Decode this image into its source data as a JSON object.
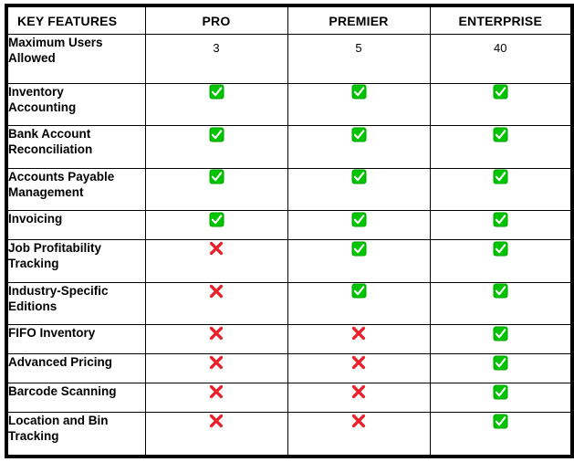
{
  "table": {
    "columns": [
      "KEY FEATURES",
      "PRO",
      "PREMIER",
      "ENTERPRISE"
    ],
    "icons": {
      "yes": "green-check-icon",
      "no": "red-cross-icon"
    },
    "colors": {
      "check_fill": "#00c400",
      "check_fill_dark": "#00a200",
      "check_glyph": "#ffffff",
      "cross": "#e8202a",
      "border": "#000000",
      "background": "#ffffff",
      "text": "#000000"
    },
    "rows": [
      {
        "feature": "Maximum Users Allowed",
        "lines": [
          "Maximum Users",
          "Allowed"
        ],
        "type": "text",
        "height": "tall",
        "pro": "3",
        "premier": "5",
        "enterprise": "40"
      },
      {
        "feature": "Inventory Accounting",
        "lines": [
          "Inventory",
          "Accounting"
        ],
        "type": "icon",
        "height": "tall",
        "pro": "yes",
        "premier": "yes",
        "enterprise": "yes"
      },
      {
        "feature": "Bank Account Reconciliation",
        "lines": [
          "Bank Account",
          "Reconciliation"
        ],
        "type": "icon",
        "height": "tall",
        "pro": "yes",
        "premier": "yes",
        "enterprise": "yes"
      },
      {
        "feature": "Accounts Payable Management",
        "lines": [
          "Accounts Payable",
          "Management"
        ],
        "type": "icon",
        "height": "tall",
        "pro": "yes",
        "premier": "yes",
        "enterprise": "yes"
      },
      {
        "feature": "Invoicing",
        "lines": [
          "Invoicing"
        ],
        "type": "icon",
        "height": "short",
        "pro": "yes",
        "premier": "yes",
        "enterprise": "yes"
      },
      {
        "feature": "Job Profitability Tracking",
        "lines": [
          "Job Profitability",
          "Tracking"
        ],
        "type": "icon",
        "height": "tall",
        "pro": "no",
        "premier": "yes",
        "enterprise": "yes"
      },
      {
        "feature": "Industry-Specific Editions",
        "lines": [
          "Industry-Specific",
          "Editions"
        ],
        "type": "icon",
        "height": "tall",
        "pro": "no",
        "premier": "yes",
        "enterprise": "yes"
      },
      {
        "feature": "FIFO Inventory",
        "lines": [
          "FIFO Inventory"
        ],
        "type": "icon",
        "height": "short",
        "pro": "no",
        "premier": "no",
        "enterprise": "yes"
      },
      {
        "feature": "Advanced Pricing",
        "lines": [
          "Advanced Pricing"
        ],
        "type": "icon",
        "height": "short",
        "pro": "no",
        "premier": "no",
        "enterprise": "yes"
      },
      {
        "feature": "Barcode Scanning",
        "lines": [
          "Barcode Scanning"
        ],
        "type": "icon",
        "height": "short",
        "pro": "no",
        "premier": "no",
        "enterprise": "yes"
      },
      {
        "feature": "Location and Bin Tracking",
        "lines": [
          "Location and Bin",
          "Tracking"
        ],
        "type": "icon",
        "height": "tall",
        "pro": "no",
        "premier": "no",
        "enterprise": "yes"
      }
    ]
  }
}
